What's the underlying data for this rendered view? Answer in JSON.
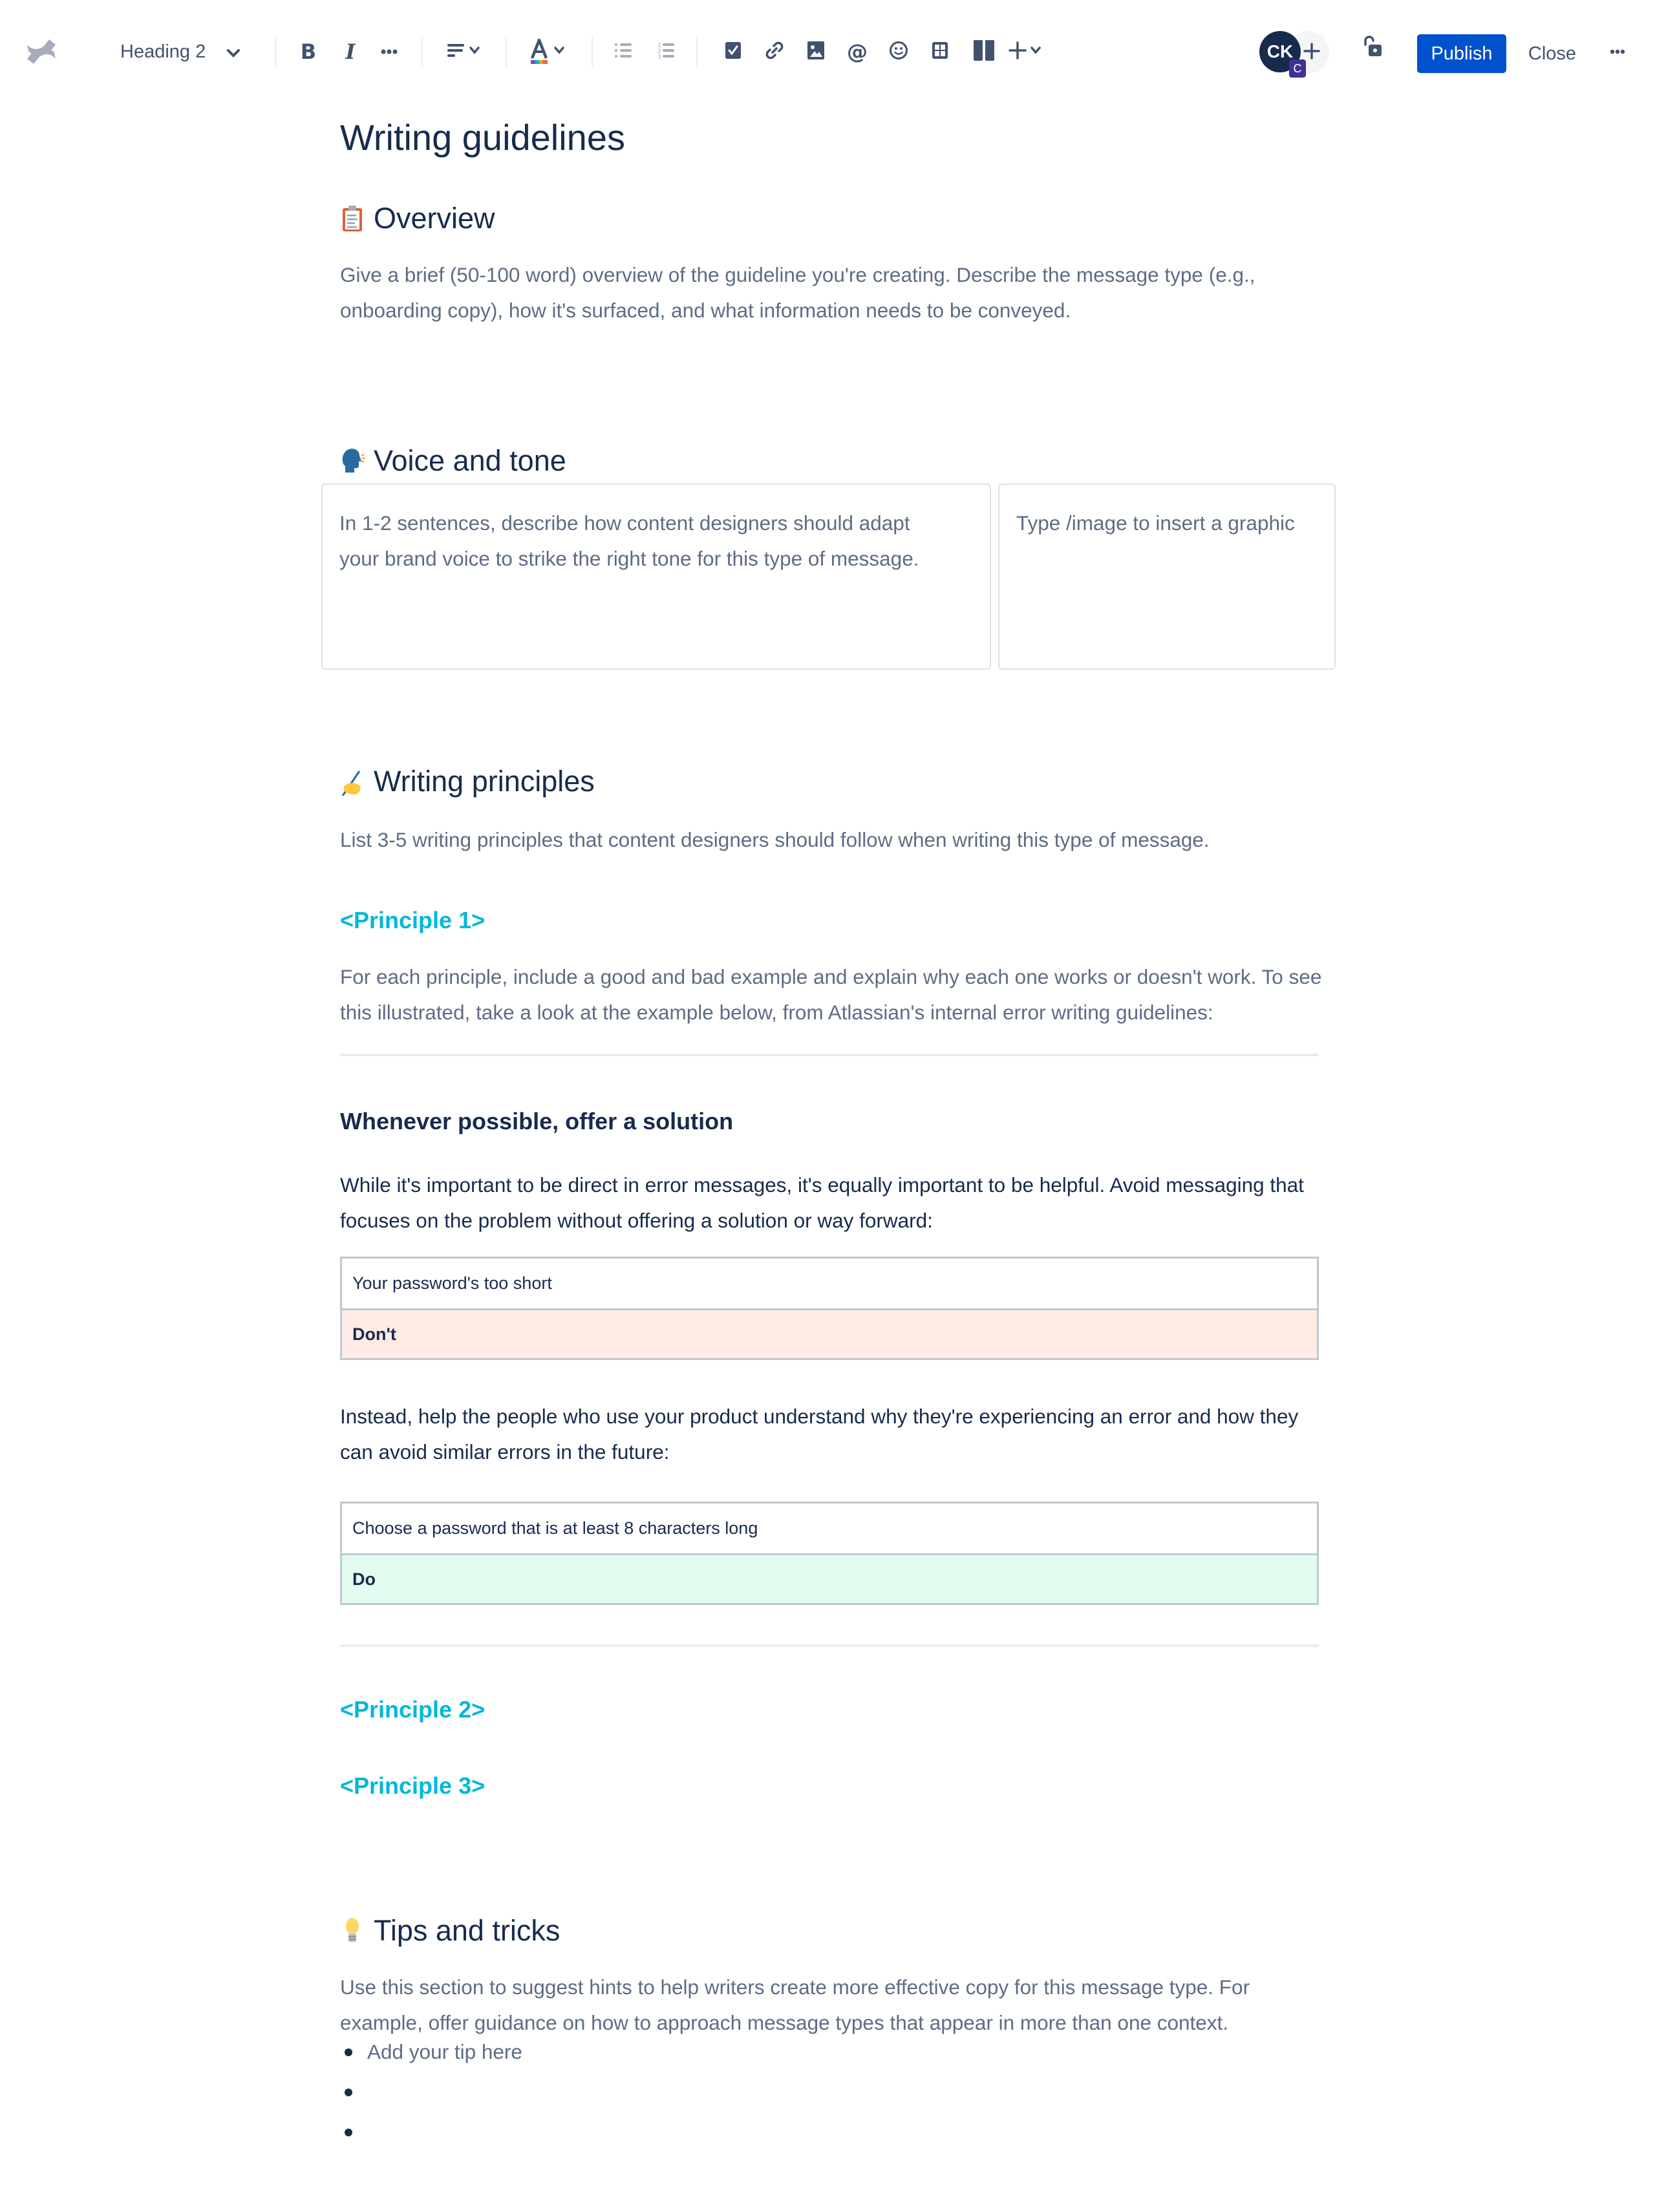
{
  "toolbar": {
    "logo": "confluence-logo",
    "text_style": "Heading 2",
    "buttons": {
      "bold": "bold-icon",
      "italic": "italic-icon",
      "more_formatting": "more-icon",
      "alignment": "align-left-icon",
      "text_color": "text-color-icon",
      "bullet_list": "bullet-list-icon",
      "numbered_list": "numbered-list-icon",
      "action_item": "checkbox-icon",
      "link": "link-icon",
      "image": "image-icon",
      "mention": "mention-icon",
      "emoji": "emoji-icon",
      "table": "table-icon",
      "layouts": "layout-icon",
      "insert": "plus-icon"
    },
    "avatar_initials": "CK",
    "avatar_badge": "C",
    "restrictions": "unlock-icon",
    "publish_label": "Publish",
    "close_label": "Close",
    "more": "more-icon",
    "colors": {
      "primary": "#0052cc",
      "avatar_bg": "#172b4d",
      "badge_bg": "#403294",
      "text_color_swatches": [
        "#6554c0",
        "#00b8d9",
        "#ff991f",
        "#de6b4e"
      ]
    }
  },
  "page": {
    "title": "Writing guidelines",
    "sections": {
      "overview": {
        "emoji": "clipboard",
        "heading": "Overview",
        "body": "Give a brief (50-100 word) overview of the guideline you're creating. Describe the message type (e.g., onboarding copy), how it's surfaced, and what information needs to be conveyed."
      },
      "voice": {
        "emoji": "speaking-head",
        "heading": "Voice and tone",
        "left_cell": "In 1-2 sentences, describe how content designers should adapt your brand voice to strike the right tone for this type of message.",
        "right_cell": "Type /image to insert a graphic"
      },
      "principles": {
        "emoji": "writing-hand",
        "heading": "Writing principles",
        "intro": "List 3-5 writing principles that content designers should follow when writing this type of message.",
        "principle_1": "<Principle 1>",
        "principle_1_body": "For each principle, include a good and bad example and explain why each one works or doesn't work. To see this illustrated, take a look at the example below, from Atlassian's internal error writing guidelines:",
        "example": {
          "heading": "Whenever possible, offer a solution",
          "para_1": "While it's important to be direct in error messages, it's equally important to be helpful. Avoid messaging that focuses on the problem without offering a solution or way forward:",
          "bad_table": {
            "example_text": "Your password's too short",
            "verdict": "Don't",
            "verdict_color": "#ffebe6"
          },
          "para_2": "Instead, help the people who use your product understand why they're experiencing an error and how they can avoid similar errors in the future:",
          "good_table": {
            "example_text": "Choose a password that is at least 8 characters long",
            "verdict": "Do",
            "verdict_color": "#e3fcef"
          }
        },
        "principle_2": "<Principle 2>",
        "principle_3": "<Principle 3>",
        "principle_color": "#00b8d9"
      },
      "tips": {
        "emoji": "light-bulb",
        "heading": "Tips and tricks",
        "body": "Use this section to suggest hints to help writers create more effective copy for this message type. For example, offer guidance on how to approach message types that appear in more than one context.",
        "bullets": [
          "Add your tip here",
          "",
          ""
        ]
      }
    }
  }
}
